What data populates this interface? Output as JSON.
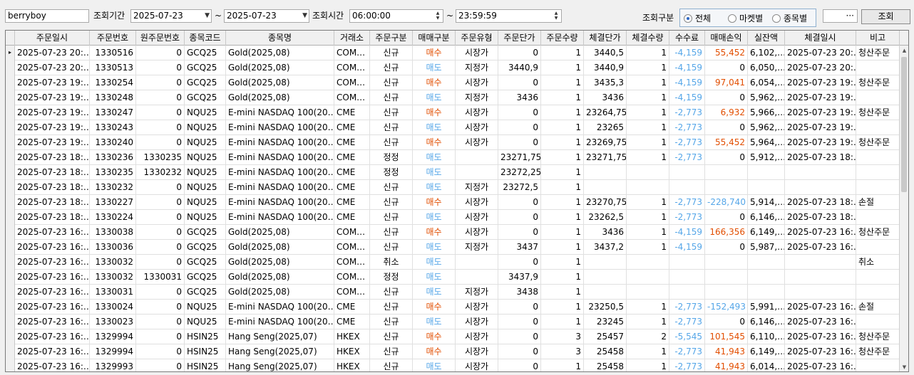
{
  "toolbar": {
    "account": "berryboy",
    "period_label": "조회기간",
    "date_from": "2025-07-23",
    "tilde": "~",
    "date_to": "2025-07-23",
    "time_label": "조회시간",
    "time_from": "06:00:00",
    "time_to": "23:59:59",
    "kind_label": "조회구분",
    "radio_all": "전체",
    "radio_market": "마켓별",
    "radio_item": "종목별",
    "more_btn": "···",
    "search_btn": "조회"
  },
  "columns": [
    "주문일시",
    "주문번호",
    "원주문번호",
    "종목코드",
    "종목명",
    "거래소",
    "주문구분",
    "매매구분",
    "주문유형",
    "주문단가",
    "주문수량",
    "체결단가",
    "체결수량",
    "수수료",
    "매매손익",
    "실잔액",
    "체결일시",
    "비고"
  ],
  "rows": [
    [
      "2025-07-23 20:…",
      "1330516",
      "0",
      "GCQ25",
      "Gold(2025,08)",
      "COM…",
      "신규",
      "매수",
      "시장가",
      "0",
      "1",
      "3440,5",
      "1",
      "-4,159",
      "55,452",
      "6,102,…",
      "2025-07-23 20:…",
      "청산주문"
    ],
    [
      "2025-07-23 20:…",
      "1330513",
      "0",
      "GCQ25",
      "Gold(2025,08)",
      "COM…",
      "신규",
      "매도",
      "지정가",
      "3440,9",
      "1",
      "3440,9",
      "1",
      "-4,159",
      "0",
      "6,050,…",
      "2025-07-23 20:…",
      ""
    ],
    [
      "2025-07-23 19:…",
      "1330254",
      "0",
      "GCQ25",
      "Gold(2025,08)",
      "COM…",
      "신규",
      "매수",
      "시장가",
      "0",
      "1",
      "3435,3",
      "1",
      "-4,159",
      "97,041",
      "6,054,…",
      "2025-07-23 19:…",
      "청산주문"
    ],
    [
      "2025-07-23 19:…",
      "1330248",
      "0",
      "GCQ25",
      "Gold(2025,08)",
      "COM…",
      "신규",
      "매도",
      "지정가",
      "3436",
      "1",
      "3436",
      "1",
      "-4,159",
      "0",
      "5,962,…",
      "2025-07-23 19:…",
      ""
    ],
    [
      "2025-07-23 19:…",
      "1330247",
      "0",
      "NQU25",
      "E-mini NASDAQ 100(20…",
      "CME",
      "신규",
      "매수",
      "시장가",
      "0",
      "1",
      "23264,75",
      "1",
      "-2,773",
      "6,932",
      "5,966,…",
      "2025-07-23 19:…",
      "청산주문"
    ],
    [
      "2025-07-23 19:…",
      "1330243",
      "0",
      "NQU25",
      "E-mini NASDAQ 100(20…",
      "CME",
      "신규",
      "매도",
      "시장가",
      "0",
      "1",
      "23265",
      "1",
      "-2,773",
      "0",
      "5,962,…",
      "2025-07-23 19:…",
      ""
    ],
    [
      "2025-07-23 19:…",
      "1330240",
      "0",
      "NQU25",
      "E-mini NASDAQ 100(20…",
      "CME",
      "신규",
      "매수",
      "시장가",
      "0",
      "1",
      "23269,75",
      "1",
      "-2,773",
      "55,452",
      "5,964,…",
      "2025-07-23 19:…",
      "청산주문"
    ],
    [
      "2025-07-23 18:…",
      "1330236",
      "1330235",
      "NQU25",
      "E-mini NASDAQ 100(20…",
      "CME",
      "정정",
      "매도",
      "",
      "23271,75",
      "1",
      "23271,75",
      "1",
      "-2,773",
      "0",
      "5,912,…",
      "2025-07-23 18:…",
      ""
    ],
    [
      "2025-07-23 18:…",
      "1330235",
      "1330232",
      "NQU25",
      "E-mini NASDAQ 100(20…",
      "CME",
      "정정",
      "매도",
      "",
      "23272,25",
      "1",
      "",
      "",
      "",
      "",
      "",
      "",
      ""
    ],
    [
      "2025-07-23 18:…",
      "1330232",
      "0",
      "NQU25",
      "E-mini NASDAQ 100(20…",
      "CME",
      "신규",
      "매도",
      "지정가",
      "23272,5",
      "1",
      "",
      "",
      "",
      "",
      "",
      "",
      ""
    ],
    [
      "2025-07-23 18:…",
      "1330227",
      "0",
      "NQU25",
      "E-mini NASDAQ 100(20…",
      "CME",
      "신규",
      "매수",
      "시장가",
      "0",
      "1",
      "23270,75",
      "1",
      "-2,773",
      "-228,740",
      "5,914,…",
      "2025-07-23 18:…",
      "손절"
    ],
    [
      "2025-07-23 18:…",
      "1330224",
      "0",
      "NQU25",
      "E-mini NASDAQ 100(20…",
      "CME",
      "신규",
      "매도",
      "시장가",
      "0",
      "1",
      "23262,5",
      "1",
      "-2,773",
      "0",
      "6,146,…",
      "2025-07-23 18:…",
      ""
    ],
    [
      "2025-07-23 16:…",
      "1330038",
      "0",
      "GCQ25",
      "Gold(2025,08)",
      "COM…",
      "신규",
      "매수",
      "시장가",
      "0",
      "1",
      "3436",
      "1",
      "-4,159",
      "166,356",
      "6,149,…",
      "2025-07-23 16:…",
      "청산주문"
    ],
    [
      "2025-07-23 16:…",
      "1330036",
      "0",
      "GCQ25",
      "Gold(2025,08)",
      "COM…",
      "신규",
      "매도",
      "지정가",
      "3437",
      "1",
      "3437,2",
      "1",
      "-4,159",
      "0",
      "5,987,…",
      "2025-07-23 16:…",
      ""
    ],
    [
      "2025-07-23 16:…",
      "1330032",
      "0",
      "GCQ25",
      "Gold(2025,08)",
      "COM…",
      "취소",
      "매도",
      "",
      "0",
      "1",
      "",
      "",
      "",
      "",
      "",
      "",
      "취소"
    ],
    [
      "2025-07-23 16:…",
      "1330032",
      "1330031",
      "GCQ25",
      "Gold(2025,08)",
      "COM…",
      "정정",
      "매도",
      "",
      "3437,9",
      "1",
      "",
      "",
      "",
      "",
      "",
      "",
      ""
    ],
    [
      "2025-07-23 16:…",
      "1330031",
      "0",
      "GCQ25",
      "Gold(2025,08)",
      "COM…",
      "신규",
      "매도",
      "지정가",
      "3438",
      "1",
      "",
      "",
      "",
      "",
      "",
      "",
      ""
    ],
    [
      "2025-07-23 16:…",
      "1330024",
      "0",
      "NQU25",
      "E-mini NASDAQ 100(20…",
      "CME",
      "신규",
      "매수",
      "시장가",
      "0",
      "1",
      "23250,5",
      "1",
      "-2,773",
      "-152,493",
      "5,991,…",
      "2025-07-23 16:…",
      "손절"
    ],
    [
      "2025-07-23 16:…",
      "1330023",
      "0",
      "NQU25",
      "E-mini NASDAQ 100(20…",
      "CME",
      "신규",
      "매도",
      "시장가",
      "0",
      "1",
      "23245",
      "1",
      "-2,773",
      "0",
      "6,146,…",
      "2025-07-23 16:…",
      ""
    ],
    [
      "2025-07-23 16:…",
      "1329994",
      "0",
      "HSIN25",
      "Hang Seng(2025,07)",
      "HKEX",
      "신규",
      "매수",
      "시장가",
      "0",
      "3",
      "25457",
      "2",
      "-5,545",
      "101,545",
      "6,110,…",
      "2025-07-23 16:…",
      "청산주문"
    ],
    [
      "2025-07-23 16:…",
      "1329994",
      "0",
      "HSIN25",
      "Hang Seng(2025,07)",
      "HKEX",
      "신규",
      "매수",
      "시장가",
      "0",
      "3",
      "25458",
      "1",
      "-2,773",
      "41,943",
      "6,149,…",
      "2025-07-23 16:…",
      "청산주문"
    ],
    [
      "2025-07-23 16:…",
      "1329993",
      "0",
      "HSIN25",
      "Hang Seng(2025,07)",
      "HKEX",
      "신규",
      "매도",
      "시장가",
      "0",
      "1",
      "25458",
      "1",
      "-2,773",
      "41,943",
      "6,014,…",
      "2025-07-23 16:…",
      ""
    ]
  ],
  "colors": {
    "buy": "#e24e00",
    "sell": "#55a6e8"
  }
}
